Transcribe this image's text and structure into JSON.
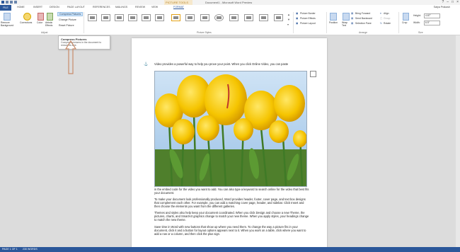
{
  "title_bar": {
    "document_title": "Document1 - Microsoft Word Preview",
    "contextual_tab_group": "PICTURE TOOLS",
    "window_controls": [
      "?",
      "–",
      "□",
      "×"
    ]
  },
  "tabs": {
    "file": "FILE",
    "home": "HOME",
    "insert": "INSERT",
    "design": "DESIGN",
    "page_layout": "PAGE LAYOUT",
    "references": "REFERENCES",
    "mailings": "MAILINGS",
    "review": "REVIEW",
    "view": "VIEW",
    "format": "FORMAT"
  },
  "user_name": "Satya Prakash",
  "ribbon": {
    "remove_background": "Remove Background",
    "corrections": "Corrections",
    "color": "Color",
    "artistic_effects": "Artistic Effects",
    "adjust_menu": {
      "compress": "Compress Pictures",
      "change": "Change Picture",
      "reset": "Reset Picture"
    },
    "adjust_group": "Adjust",
    "picture_styles_group": "Picture Styles",
    "picture_border": "Picture Border",
    "picture_effects": "Picture Effects",
    "picture_layout": "Picture Layout",
    "position": "Position",
    "wrap_text": "Wrap Text",
    "bring_forward": "Bring Forward",
    "send_backward": "Send Backward",
    "selection_pane": "Selection Pane",
    "align": "Align",
    "group": "Group",
    "rotate": "Rotate",
    "arrange_group": "Arrange",
    "crop": "Crop",
    "height_label": "Height:",
    "height_value": "4.87\"",
    "width_label": "Width:",
    "width_value": "6.5\"",
    "size_group": "Size"
  },
  "tooltip": {
    "title": "Compress Pictures",
    "body": "Compress pictures in the document to reduce its size."
  },
  "document": {
    "para1": "Video provides a powerful way to help you prove your point. When you click Online Video, you can paste",
    "para2": "in the embed code for the video you want to add. You can also type a keyword to search online for the video that best fits your document.",
    "para3": "To make your document look professionally produced, Word provides header, footer, cover page, and text box designs that complement each other. For example, you can add a matching cover page, header, and sidebar. Click Insert and then choose the elements you want from the different galleries.",
    "para4": "Themes and styles also help keep your document coordinated. When you click Design and choose a new Theme, the pictures, charts, and SmartArt graphics change to match your new theme. When you apply styles, your headings change to match the new theme.",
    "para5": "Save time in Word with new buttons that show up where you need them. To change the way a picture fits in your document, click it and a button for layout options appears next to it. When you work on a table, click where you want to add a row or a column, and then click the plus sign."
  },
  "status_bar": {
    "page": "PAGE 1 OF 1",
    "words": "230 WORDS"
  },
  "colors": {
    "accent": "#2b579a",
    "contextual": "#f6e8cc",
    "tulip_yellow": "#f2c300"
  }
}
